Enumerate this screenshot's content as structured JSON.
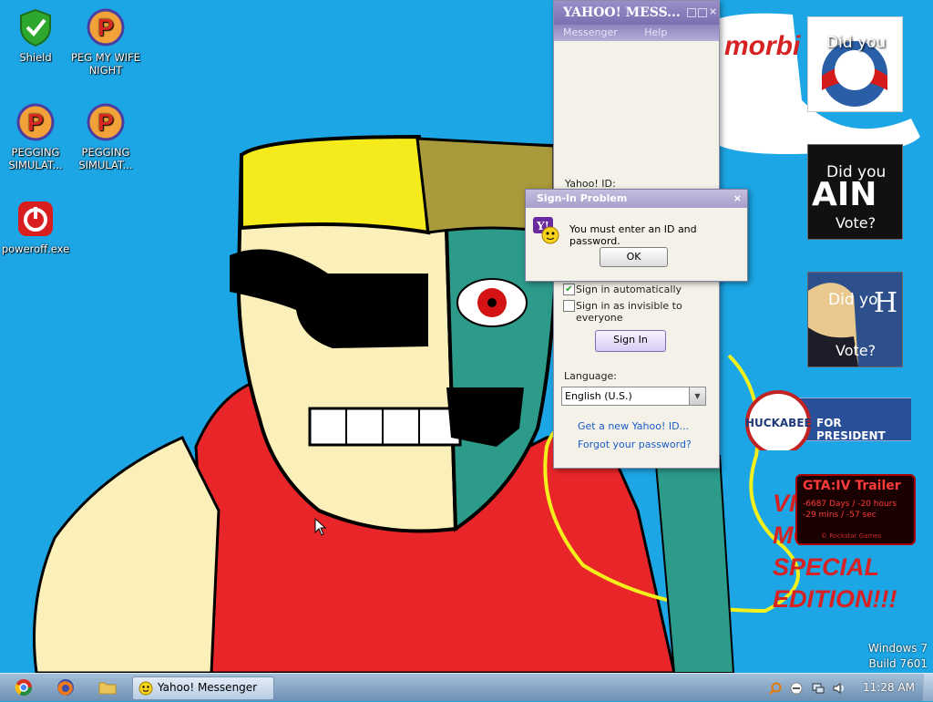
{
  "desktop": {
    "icons": [
      {
        "name": "desktop-icon-shield",
        "label": "Shield",
        "icon": "shield-check-icon"
      },
      {
        "name": "desktop-icon-peg-my-wife-night",
        "label": "PEG MY WIFE NIGHT",
        "icon": "p-logo-icon"
      },
      {
        "name": "desktop-icon-pegging-simulat-1",
        "label": "PEGGING SIMULAT...",
        "icon": "p-logo-icon"
      },
      {
        "name": "desktop-icon-pegging-simulat-2",
        "label": "PEGGING SIMULAT...",
        "icon": "p-logo-icon"
      },
      {
        "name": "desktop-icon-poweroff",
        "label": "poweroff.exe",
        "icon": "power-icon"
      }
    ],
    "wallpaper_text": {
      "top_banner": "morbi",
      "bottom_lines": [
        "VI",
        "MO",
        "SPECIAL",
        "EDITION!!!"
      ]
    },
    "watermark": {
      "line1": "Windows 7",
      "line2": "Build 7601"
    },
    "gadgets": {
      "obama_text": "Did you",
      "mccain_top": "Did you",
      "mccain_middle": "AIN",
      "mccain_bottom": "Vote?",
      "hillary_top": "Did yo",
      "hillary_letter": "H",
      "hillary_bottom": "Vote?",
      "huckabee_name": "HUCKABEE",
      "huckabee_tagline": "FOR PRESIDENT",
      "gta_title": "GTA:IV  Trailer",
      "gta_line1": "-6687 Days / -20 hours",
      "gta_line2": "-29 mins / -57 sec",
      "gta_footer": "© Rockstar Games"
    }
  },
  "messenger": {
    "title": "YAHOO! MESS...",
    "menu": [
      "Messenger",
      "Help"
    ],
    "yahoo_id_label": "Yahoo! ID:",
    "sign_in_automatically": "Sign in automatically",
    "sign_in_automatically_checked": true,
    "sign_in_invisible": "Sign in as invisible to everyone",
    "sign_in_invisible_checked": false,
    "sign_in_button": "Sign In",
    "language_label": "Language:",
    "language_value": "English (U.S.)",
    "get_new_id_link": "Get a new Yahoo! ID...",
    "forgot_password_link": "Forgot your password?"
  },
  "dialog": {
    "title": "Sign-In Problem",
    "message": "You must enter an ID and password.",
    "ok_button": "OK"
  },
  "taskbar": {
    "pinned": [
      "chrome-icon",
      "firefox-icon",
      "folder-icon"
    ],
    "active_task": "Yahoo! Messenger",
    "clock": "11:28 AM",
    "colors": {
      "taskbar_top": "#a4bfd8",
      "taskbar_bottom": "#6f90b4",
      "desktop": "#1ca6e6"
    }
  }
}
